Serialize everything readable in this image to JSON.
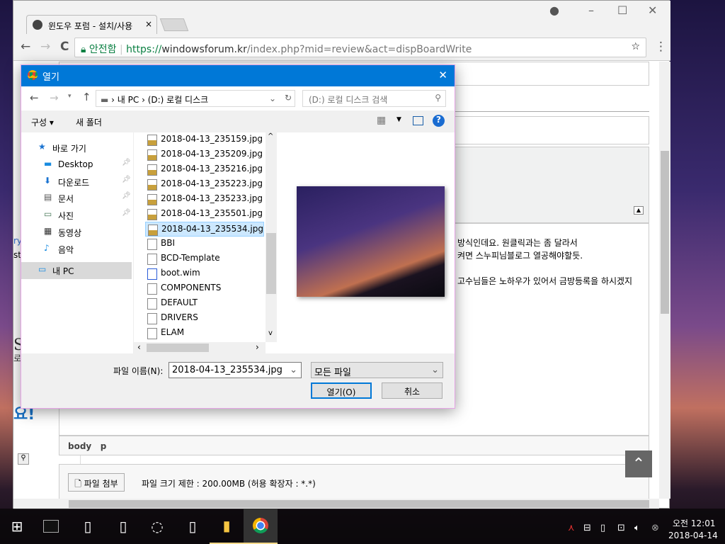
{
  "browser": {
    "tab_title": "윈도우 포럼 - 설치/사용",
    "tab_close": "×",
    "secure_label": "안전함",
    "url_scheme": "https://",
    "url_host": "windowsforum.kr",
    "url_path": "/index.php?mid=review&act=dispBoardWrite",
    "minimize": "–",
    "maximize": "☐",
    "close": "✕",
    "back": "←",
    "forward": "→",
    "reload": "C",
    "star": "☆",
    "menu": "⋮"
  },
  "page": {
    "text_lines": [
      "방식인데요. 원클릭과는 좀 달라서",
      "켜면 스누피님블로그 열공해야할듯.",
      "고수님들은 노하우가 있어서 금방등록을 하시겠지"
    ],
    "left_fragments": [
      "ry",
      "ste",
      "S",
      "로",
      "요!"
    ],
    "editor_path": [
      "body",
      "p"
    ],
    "attach_button": "파일 첨부",
    "attach_info": "파일 크기 제한 : 200.00MB (허용 확장자 : *.*)",
    "scroll_top_icon": "chevron-up-icon"
  },
  "dialog": {
    "title": "열기",
    "close": "✕",
    "breadcrumb": [
      "내 PC",
      "(D:) 로컬 디스크"
    ],
    "search_placeholder": "(D:) 로컬 디스크 검색",
    "organize": "구성 ▾",
    "new_folder": "새 폴더",
    "nav": [
      {
        "label": "바로 가기",
        "icon": "star-icon"
      },
      {
        "label": "Desktop",
        "icon": "desktop-icon",
        "pinned": true
      },
      {
        "label": "다운로드",
        "icon": "download-icon",
        "pinned": true
      },
      {
        "label": "문서",
        "icon": "document-icon",
        "pinned": true
      },
      {
        "label": "사진",
        "icon": "picture-icon",
        "pinned": true
      },
      {
        "label": "동영상",
        "icon": "video-icon"
      },
      {
        "label": "음악",
        "icon": "music-icon"
      },
      {
        "label": "내 PC",
        "icon": "pc-icon",
        "selected": true
      }
    ],
    "files": [
      {
        "name": "2018-04-13_235159.jpg",
        "type": "jpg"
      },
      {
        "name": "2018-04-13_235209.jpg",
        "type": "jpg"
      },
      {
        "name": "2018-04-13_235216.jpg",
        "type": "jpg"
      },
      {
        "name": "2018-04-13_235223.jpg",
        "type": "jpg"
      },
      {
        "name": "2018-04-13_235233.jpg",
        "type": "jpg"
      },
      {
        "name": "2018-04-13_235501.jpg",
        "type": "jpg"
      },
      {
        "name": "2018-04-13_235534.jpg",
        "type": "jpg",
        "selected": true
      },
      {
        "name": "BBI",
        "type": "file"
      },
      {
        "name": "BCD-Template",
        "type": "file"
      },
      {
        "name": "boot.wim",
        "type": "wim"
      },
      {
        "name": "COMPONENTS",
        "type": "file"
      },
      {
        "name": "DEFAULT",
        "type": "file"
      },
      {
        "name": "DRIVERS",
        "type": "file"
      },
      {
        "name": "ELAM",
        "type": "file"
      }
    ],
    "filename_label": "파일 이름(N):",
    "filename_value": "2018-04-13_235534.jpg",
    "filter_value": "모든 파일",
    "open_button": "열기(O)",
    "cancel_button": "취소"
  },
  "taskbar": {
    "clock_time": "오전 12:01",
    "clock_date": "2018-04-14"
  },
  "colors": {
    "dialog_title": "#0078d7",
    "secure": "#0b8043",
    "selection": "#cce8ff"
  }
}
